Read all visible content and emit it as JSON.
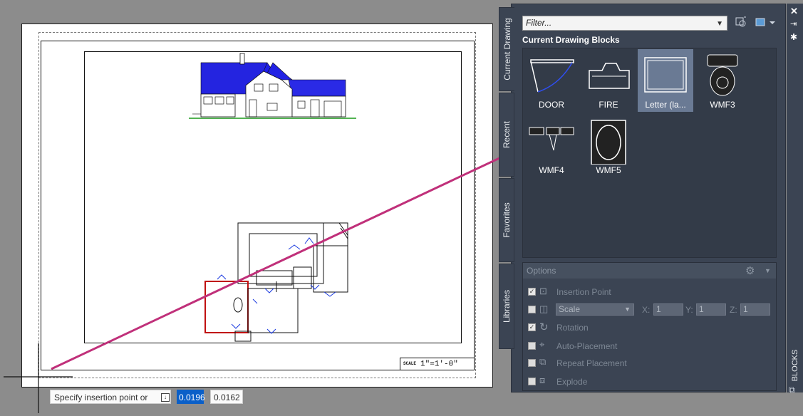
{
  "scale_label": "1\"=1'-0\"",
  "scale_prefix": "SCALE",
  "command": {
    "prompt": "Specify insertion point or",
    "x_value": "0.0196",
    "y_value": "0.0162"
  },
  "palette": {
    "filter_placeholder": "Filter...",
    "section_title": "Current Drawing Blocks",
    "tabs": [
      "Current Drawing",
      "Recent",
      "Favorites",
      "Libraries"
    ],
    "side_title": "BLOCKS",
    "blocks": [
      {
        "label": "DOOR",
        "icon": "door-icon"
      },
      {
        "label": "FIRE",
        "icon": "fireplace-icon"
      },
      {
        "label": "Letter (la...",
        "icon": "sheet-icon",
        "selected": true
      },
      {
        "label": "WMF3",
        "icon": "toilet-icon"
      },
      {
        "label": "WMF4",
        "icon": "fixtures-icon"
      },
      {
        "label": "WMF5",
        "icon": "oval-mirror-icon"
      }
    ],
    "options": {
      "title": "Options",
      "insertion_point": "Insertion Point",
      "scale": "Scale",
      "x_label": "X:",
      "x_value": "1",
      "y_label": "Y:",
      "y_value": "1",
      "z_label": "Z:",
      "z_value": "1",
      "rotation": "Rotation",
      "auto_placement": "Auto-Placement",
      "repeat_placement": "Repeat Placement",
      "explode": "Explode",
      "checked": {
        "insertion_point": true,
        "scale": false,
        "rotation": true,
        "auto_placement": false,
        "repeat_placement": false,
        "explode": false
      }
    }
  },
  "colors": {
    "panel": "#3b4453",
    "drag_arrow": "#c0307a",
    "roof": "#2020e0",
    "selection": "#0a5fc8"
  }
}
